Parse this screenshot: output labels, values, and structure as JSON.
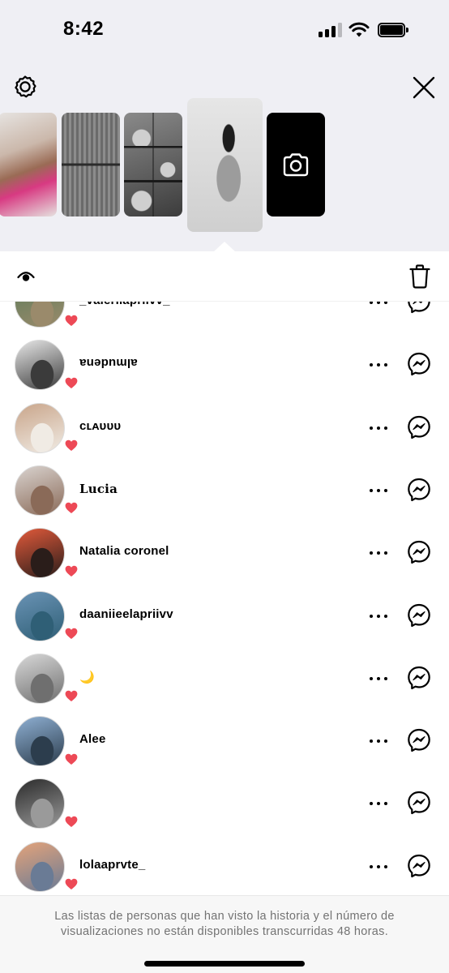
{
  "status_bar": {
    "time": "8:42"
  },
  "toolbar": {},
  "viewers": [
    {
      "username": "_valeriiapriivv_",
      "style": "normal",
      "avatar_colors": [
        "#5d7c5a",
        "#9a8a6b"
      ]
    },
    {
      "username": "almudena",
      "style": "flip",
      "avatar_colors": [
        "#e7e7e7",
        "#3b3b3b"
      ]
    },
    {
      "username": "ᴄʟᴀᴜᴜᴜ",
      "style": "normal",
      "avatar_colors": [
        "#c9a58a",
        "#f0ebe4"
      ]
    },
    {
      "username": "Lucia ",
      "style": "serif",
      "avatar_colors": [
        "#d9d3cf",
        "#8a6a58"
      ]
    },
    {
      "username": " Natalia coronel ",
      "style": "normal",
      "avatar_colors": [
        "#e25a3b",
        "#2a1d1a"
      ]
    },
    {
      "username": "daaniieelapriivv",
      "style": "normal",
      "avatar_colors": [
        "#6a93b5",
        "#2f5f76"
      ]
    },
    {
      "username": "🌙",
      "style": "normal",
      "avatar_colors": [
        "#d8d8d8",
        "#6f6f6f"
      ]
    },
    {
      "username": "Alee",
      "style": "normal",
      "avatar_colors": [
        "#8fb0d3",
        "#2c3d4d"
      ]
    },
    {
      "username": "",
      "style": "normal",
      "avatar_colors": [
        "#2b2b2b",
        "#9a9a9a"
      ]
    },
    {
      "username": "lolaaprvte_",
      "style": "normal",
      "avatar_colors": [
        "#e4a37a",
        "#6a7b95"
      ]
    }
  ],
  "footer": {
    "note": "Las listas de personas que han visto la historia y el número de visualizaciones no están disponibles transcurridas 48 horas."
  },
  "colors": {
    "heart": "#ed4956",
    "top_bg": "#efeff4",
    "footer_text": "#737373"
  },
  "icons": [
    "settings-icon",
    "close-icon",
    "camera-icon",
    "eye-icon",
    "trash-icon",
    "more-icon",
    "messenger-icon",
    "heart-icon"
  ]
}
